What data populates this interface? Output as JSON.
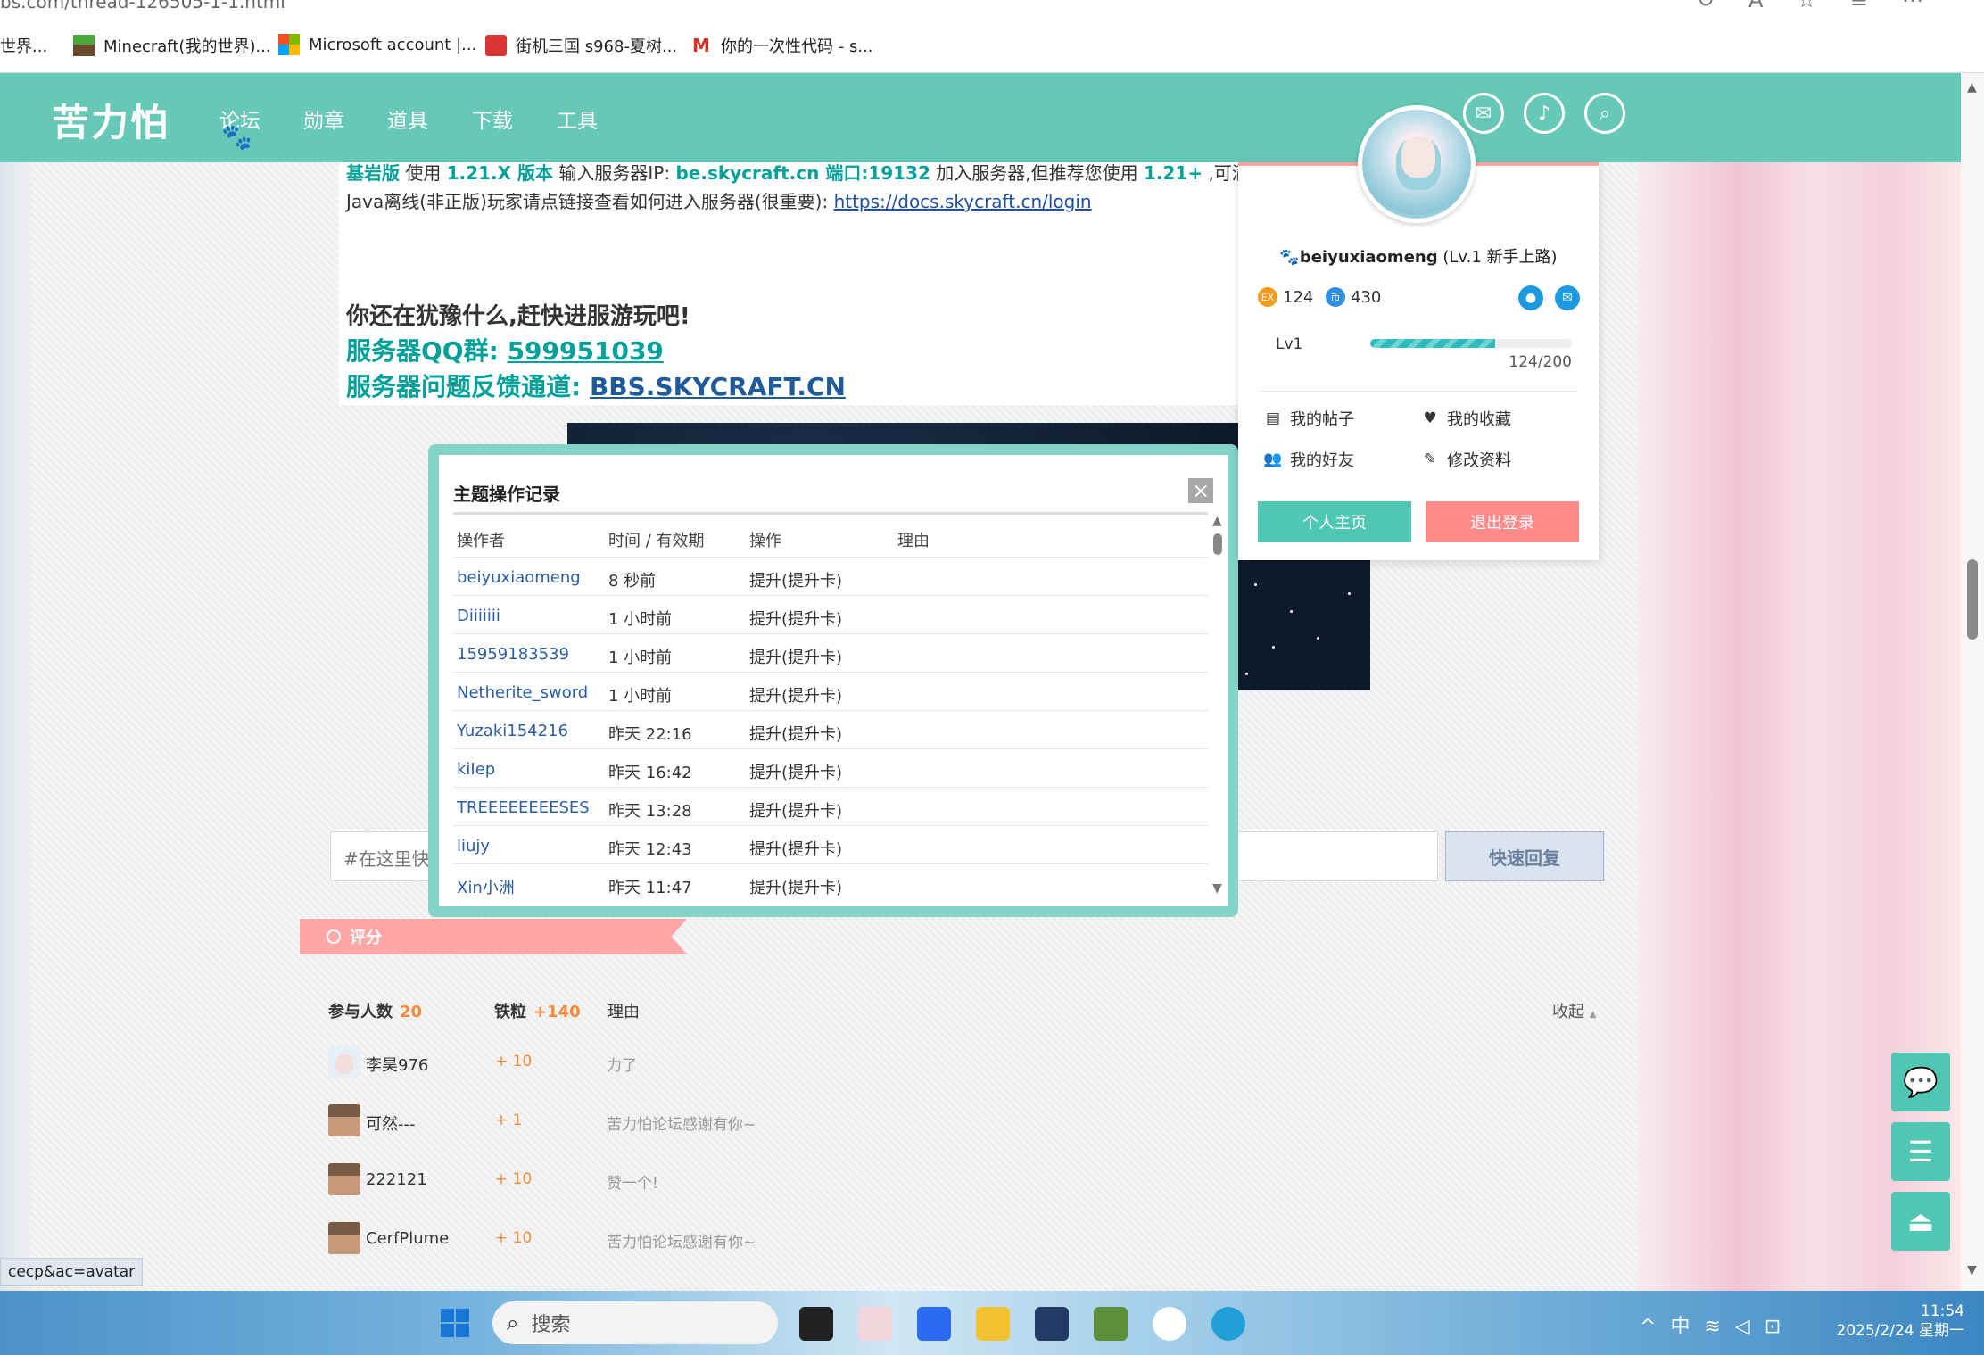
{
  "browser": {
    "url_fragment": "bs.com/thread-126505-1-1.html",
    "bookmarks": [
      {
        "label": "世界..."
      },
      {
        "label": "Minecraft(我的世界)..."
      },
      {
        "label": "Microsoft account |..."
      },
      {
        "label": "街机三国 s968-夏树..."
      },
      {
        "label": "你的一次性代码 - s..."
      }
    ]
  },
  "site": {
    "logo": "苦力怕",
    "nav": [
      "论坛",
      "勋章",
      "道具",
      "下载",
      "工具"
    ]
  },
  "post": {
    "line1_a": "基岩版",
    "line1_b": " 使用 ",
    "line1_c": "1.21.X 版本",
    "line1_d": " 输入服务器IP: ",
    "line1_e": "be.skycraft.cn",
    "line1_f": " 端口:19132",
    "line1_g": " 加入服务器,但推荐您使用 ",
    "line1_h": "1.21+",
    "line1_i": " ,可满",
    "line2_a": "Java离线(非正版)玩家请点链接查看如何进入服务器(很重要): ",
    "line2_link": "https://docs.skycraft.cn/login",
    "cta": "你还在犹豫什么,赶快进服游玩吧!",
    "qq_label": "服务器QQ群: ",
    "qq_value": "599951039",
    "feedback_label": "服务器问题反馈通道: ",
    "feedback_value": "BBS.SKYCRAFT.CN"
  },
  "reply": {
    "placeholder": "#在这里快",
    "button": "快速回复"
  },
  "rating": {
    "banner": "评分",
    "participants_label": "参与人数",
    "participants": "20",
    "currency_label": "铁粒",
    "currency_total": "+140",
    "reason_label": "理由",
    "collapse": "收起",
    "rows": [
      {
        "name": "李昊976",
        "score": "+ 10",
        "reason": "力了"
      },
      {
        "name": "可然---",
        "score": "+ 1",
        "reason": "苦力怕论坛感谢有你~"
      },
      {
        "name": "222121",
        "score": "+ 10",
        "reason": "赞一个!"
      },
      {
        "name": "CerfPlume",
        "score": "+ 10",
        "reason": "苦力怕论坛感谢有你~"
      }
    ]
  },
  "modal": {
    "title": "主题操作记录",
    "headers": [
      "操作者",
      "时间 / 有效期",
      "操作",
      "理由"
    ],
    "rows": [
      {
        "operator": "beiyuxiaomeng",
        "time": "8 秒前",
        "action": "提升(提升卡)"
      },
      {
        "operator": "Diiiiiii",
        "time": "1 小时前",
        "action": "提升(提升卡)"
      },
      {
        "operator": "15959183539",
        "time": "1 小时前",
        "action": "提升(提升卡)"
      },
      {
        "operator": "Netherite_sword",
        "time": "1 小时前",
        "action": "提升(提升卡)"
      },
      {
        "operator": "Yuzaki154216",
        "time": "昨天 22:16",
        "action": "提升(提升卡)"
      },
      {
        "operator": "kiIep",
        "time": "昨天 16:42",
        "action": "提升(提升卡)"
      },
      {
        "operator": "TREEEEEEEESES",
        "time": "昨天 13:28",
        "action": "提升(提升卡)"
      },
      {
        "operator": "liujy",
        "time": "昨天 12:43",
        "action": "提升(提升卡)"
      },
      {
        "operator": "Xin小洲",
        "time": "昨天 11:47",
        "action": "提升(提升卡)"
      }
    ]
  },
  "user_card": {
    "username": "beiyuxiaomeng",
    "level_note": "(Lv.1 新手上路)",
    "coins": "124",
    "points": "430",
    "level": "Lv1",
    "progress_text": "124/200",
    "progress": 0.62,
    "menu": [
      "我的帖子",
      "我的收藏",
      "我的好友",
      "修改资料"
    ],
    "btn_home": "个人主页",
    "btn_logout": "退出登录"
  },
  "status_link": "cecp&ac=avatar",
  "taskbar": {
    "search_placeholder": "搜索",
    "ime": "中",
    "time": "11:54",
    "date": "2025/2/24 星期一"
  },
  "colors": {
    "header": "#66c8b6",
    "accent_pink": "#ffa0a0",
    "teal_text": "#00a19a",
    "link_blue": "#2a5da3"
  }
}
